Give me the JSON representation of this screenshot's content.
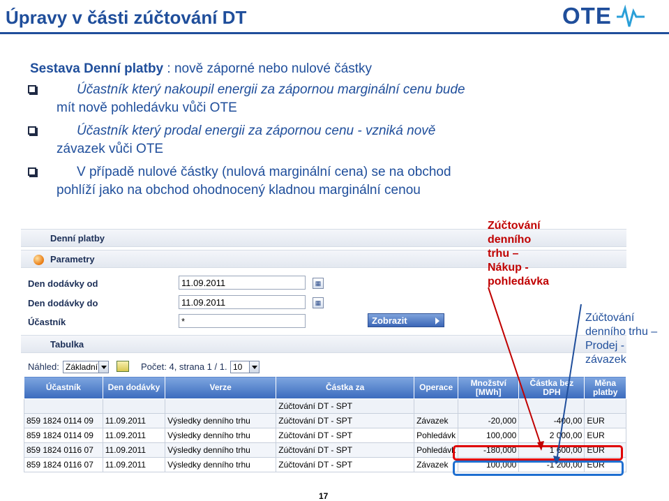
{
  "slide": {
    "title": "Úpravy v části zúčtování DT",
    "logo_text": "OTE",
    "page_number": "17"
  },
  "intro": {
    "subtitle_bold": "Sestava Denní platby",
    "subtitle_rest": " : nově záporné nebo nulové částky"
  },
  "bullets": [
    {
      "line1": "Účastník který nakoupil energii za zápornou marginální cenu bude",
      "line2": "mít nově pohledávku vůči OTE"
    },
    {
      "line1": "Účastník který prodal energii za zápornou cenu - vzniká nově",
      "line2": "závazek vůči OTE"
    },
    {
      "line1": "V případě nulové částky (nulová marginální cena) se na obchod",
      "line2": "pohlíží jako na obchod ohodnocený kladnou marginální cenou"
    }
  ],
  "app": {
    "section_title": "Denní platby",
    "params_title": "Parametry",
    "fields": [
      {
        "label": "Den dodávky od",
        "value": "11.09.2011"
      },
      {
        "label": "Den dodávky do",
        "value": "11.09.2011"
      },
      {
        "label": "Účastník",
        "value": "*"
      }
    ],
    "show_button": "Zobrazit",
    "table_title": "Tabulka",
    "view_label": "Náhled:",
    "view_value": "Základní",
    "count_text": "Počet: 4, strana 1 / 1.",
    "page_size": "10",
    "columns": [
      "Účastník",
      "Den dodávky",
      "Verze",
      "Částka za",
      "Operace",
      "Množství [MWh]",
      "Částka bez DPH",
      "Měna platby"
    ],
    "filter_row": [
      "",
      "",
      "",
      "Zúčtování DT - SPT",
      "",
      "",
      "",
      ""
    ],
    "rows": [
      [
        "859 1824 0114 09",
        "11.09.2011",
        "Výsledky denního trhu",
        "Zúčtování DT - SPT",
        "Závazek",
        "-20,000",
        "-400,00",
        "EUR"
      ],
      [
        "859 1824 0114 09",
        "11.09.2011",
        "Výsledky denního trhu",
        "Zúčtování DT - SPT",
        "Pohledávk",
        "100,000",
        "2 000,00",
        "EUR"
      ],
      [
        "859 1824 0116 07",
        "11.09.2011",
        "Výsledky denního trhu",
        "Zúčtování DT - SPT",
        "Pohledávk",
        "-180,000",
        "1 600,00",
        "EUR"
      ],
      [
        "859 1824 0116 07",
        "11.09.2011",
        "Výsledky denního trhu",
        "Zúčtování DT - SPT",
        "Závazek",
        "100,000",
        "-1 200,00",
        "EUR"
      ]
    ]
  },
  "annotations": {
    "red": [
      "Zúčtování",
      "denního",
      "trhu –",
      "Nákup -",
      "pohledávka"
    ],
    "blue": [
      "Zúčtování",
      "denního trhu –",
      "Prodej -",
      "závazek"
    ]
  },
  "colors": {
    "title_blue": "#1f4e9b",
    "annotation_red": "#c00000",
    "annotation_blue": "#1f4e9b",
    "header_blue": "#3b6bbd"
  }
}
